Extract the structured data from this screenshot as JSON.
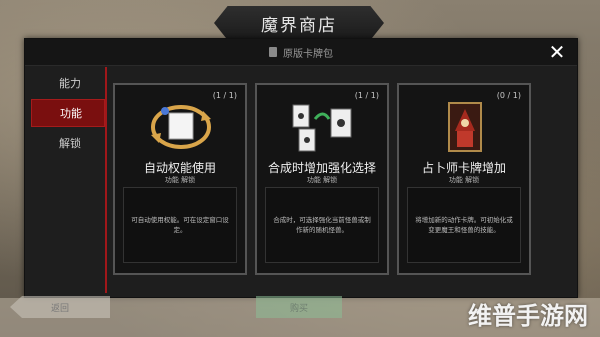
{
  "title": "魔界商店",
  "panel": {
    "header": "原版卡牌包",
    "close_icon": "close-icon"
  },
  "tabs": [
    {
      "label": "能力",
      "active": false
    },
    {
      "label": "功能",
      "active": true
    },
    {
      "label": "解锁",
      "active": false
    }
  ],
  "cards": [
    {
      "count": "(1 / 1)",
      "name": "自动权能使用",
      "tags": "功能 解锁",
      "description": "可自动使用权能。可在设定窗口设定。",
      "icon": "auto-cycle-icon"
    },
    {
      "count": "(1 / 1)",
      "name": "合成时增加强化选择",
      "tags": "功能 解锁",
      "description": "合成时，可选择强化当前怪兽或制作新的随机怪兽。",
      "icon": "card-fusion-icon"
    },
    {
      "count": "(0 / 1)",
      "name": "占卜师卡牌增加",
      "tags": "功能 解锁",
      "description": "将增加新的动作卡牌。可初始化或变更魔王和怪兽的技能。",
      "icon": "fortune-teller-card-icon"
    }
  ],
  "bottom": {
    "back_label": "返回",
    "confirm_label": "购买"
  },
  "watermark": "维普手游网",
  "colors": {
    "accent": "#7a0f0f",
    "divider": "#a0171a",
    "panel": "#1e1e1e"
  }
}
